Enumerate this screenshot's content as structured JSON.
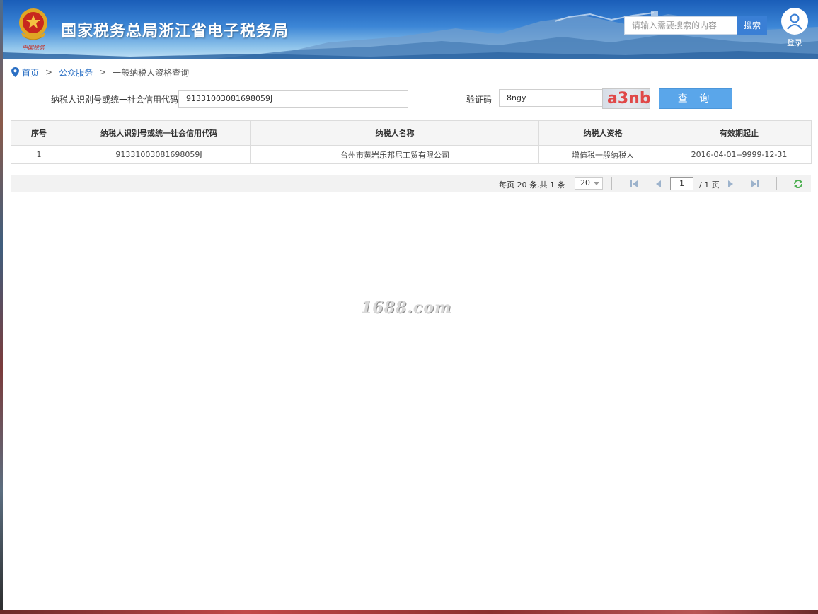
{
  "header": {
    "site_title": "国家税务总局浙江省电子税务局",
    "search_placeholder": "请输入需要搜索的内容",
    "search_button": "搜索",
    "login_label": "登录"
  },
  "breadcrumb": {
    "home": "首页",
    "separator": ">",
    "public_service": "公众服务",
    "current": "一般纳税人资格查询"
  },
  "query_form": {
    "taxpayer_id_label": "纳税人识别号或统一社会信用代码",
    "taxpayer_id_value": "91331003081698059J",
    "captcha_label": "验证码",
    "captcha_input_value": "8ngy",
    "captcha_image_text": "a3nb",
    "query_button": "查 询"
  },
  "table": {
    "columns": [
      "序号",
      "纳税人识别号或统一社会信用代码",
      "纳税人名称",
      "纳税人资格",
      "有效期起止"
    ],
    "rows": [
      [
        "1",
        "91331003081698059J",
        "台州市黄岩乐邦尼工贸有限公司",
        "增值税一般纳税人",
        "2016-04-01--9999-12-31"
      ]
    ]
  },
  "pager": {
    "info": "每页 20 条,共 1 条",
    "page_size": "20",
    "current_page": "1",
    "total_pages": "/ 1 页"
  },
  "watermark": "1688.com",
  "colors": {
    "header_blue": "#1a5db8",
    "link_blue": "#2a6fc4",
    "query_button": "#5aa6ea",
    "search_button": "#3a7fd5"
  }
}
